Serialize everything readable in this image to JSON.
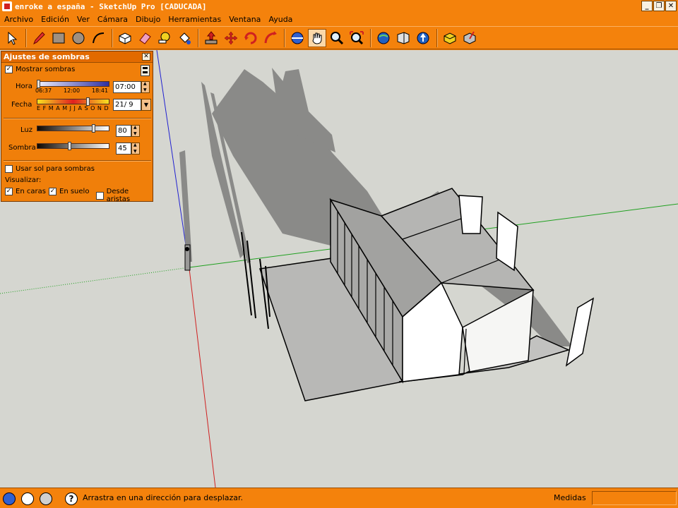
{
  "window": {
    "title": "enroke a españa - SketchUp Pro [CADUCADA]",
    "buttons": {
      "minimize": "_",
      "restore": "❐",
      "close": "✕"
    }
  },
  "menu": [
    "Archivo",
    "Edición",
    "Ver",
    "Cámara",
    "Dibujo",
    "Herramientas",
    "Ventana",
    "Ayuda"
  ],
  "toolbar": {
    "tools": [
      "select-arrow-icon",
      "pencil-icon",
      "rectangle-icon",
      "circle-icon",
      "arc-icon",
      "make-component-icon",
      "eraser-icon",
      "tape-measure-icon",
      "paint-bucket-icon",
      "push-pull-icon",
      "move-icon",
      "rotate-icon",
      "offset-icon",
      "orbit-icon",
      "pan-hand-icon",
      "zoom-icon",
      "zoom-extents-icon",
      "get-models-icon",
      "share-model-icon",
      "google-earth-icon",
      "get-component-icon",
      "share-component-icon"
    ]
  },
  "shadow_panel": {
    "title": "Ajustes de sombras",
    "show_shadows": {
      "label": "Mostrar sombras",
      "checked": "✓"
    },
    "hora": {
      "label": "Hora",
      "tick_left": "06:37",
      "tick_mid": "12:00",
      "tick_right": "18:41",
      "value": "07:00"
    },
    "fecha": {
      "label": "Fecha",
      "months": "E F M A M J J A S O N D",
      "value": "21/ 9"
    },
    "luz": {
      "label": "Luz",
      "value": "80",
      "level": 0.8
    },
    "sombra": {
      "label": "Sombra",
      "value": "45",
      "level": 0.45
    },
    "use_sun": {
      "label": "Usar sol para sombras",
      "checked": ""
    },
    "visualizar": {
      "label": "Visualizar:"
    },
    "en_caras": {
      "label": "En caras",
      "checked": "✓"
    },
    "en_suelo": {
      "label": "En suelo",
      "checked": "✓"
    },
    "desde_aristas": {
      "label": "Desde aristas",
      "checked": ""
    }
  },
  "status": {
    "hint": "Arrastra en una dirección para desplazar.",
    "measure_label": "Medidas",
    "measure_value": ""
  },
  "colors": {
    "chrome": "#f4820c",
    "viewport": "#d5d6d0",
    "axis_red": "#d02020",
    "axis_green": "#20a020",
    "axis_blue": "#2020d0"
  }
}
